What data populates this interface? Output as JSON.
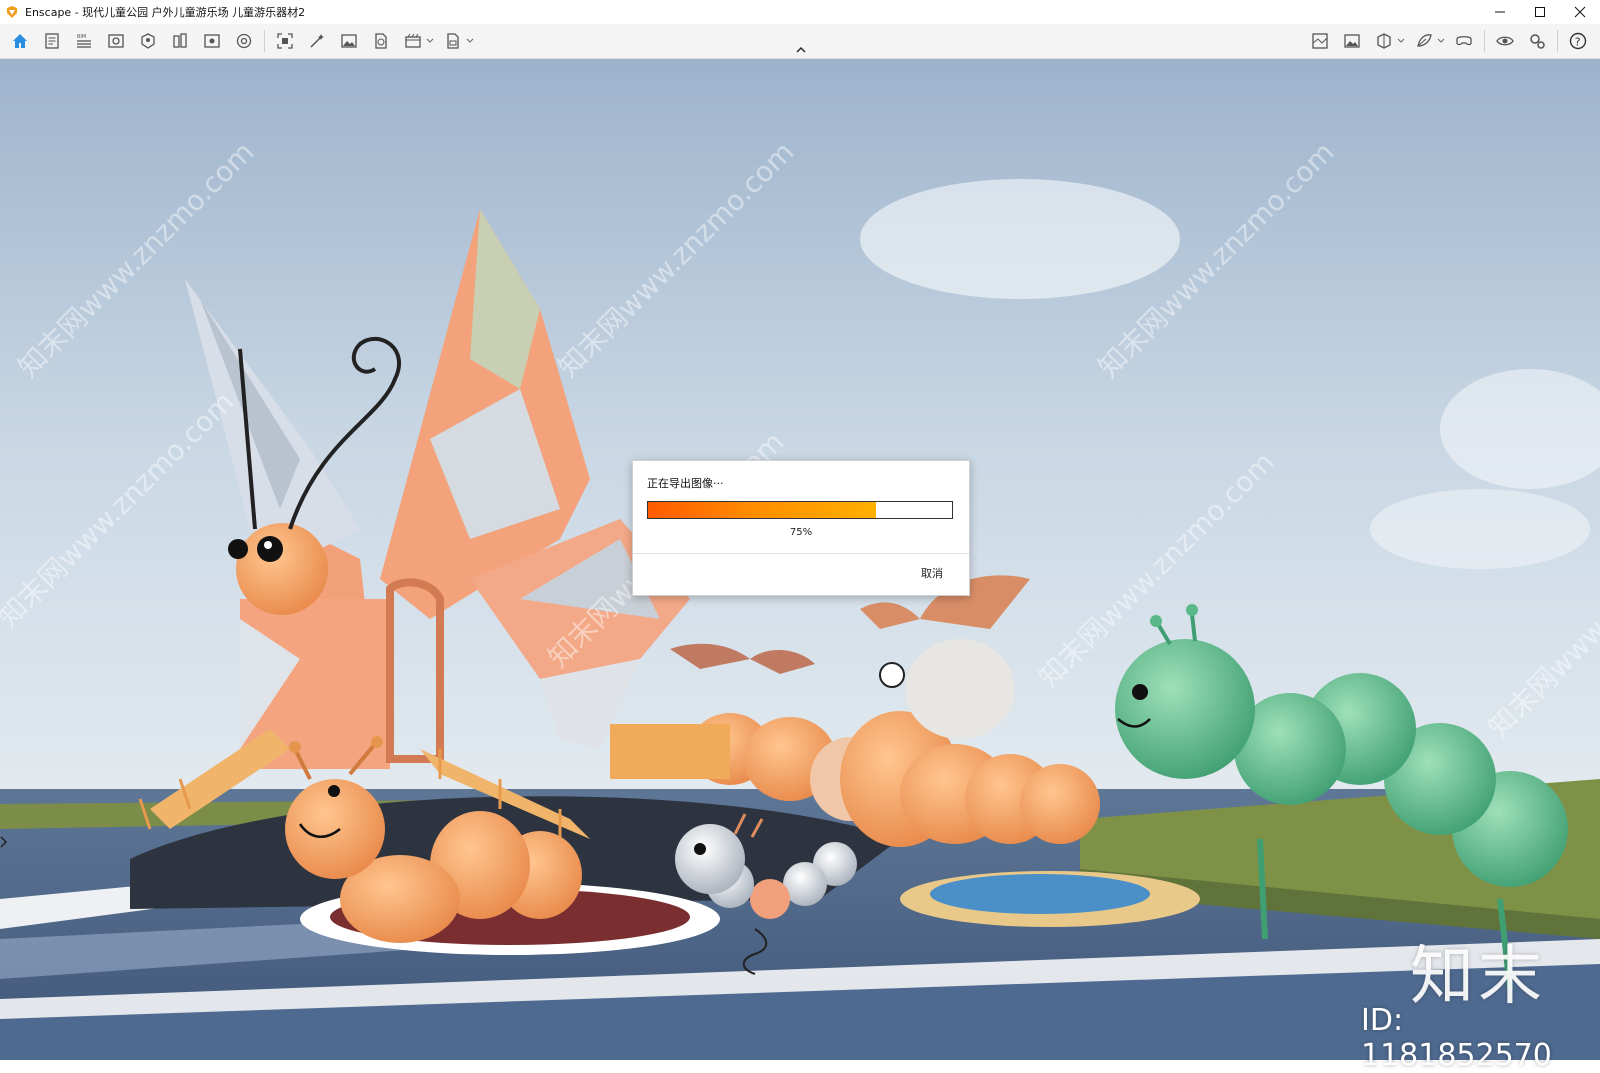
{
  "window": {
    "title": "Enscape - 现代儿童公园 户外儿童游乐场 儿童游乐器材2",
    "icon": "enscape-logo-icon",
    "controls": [
      "minimize-icon",
      "maximize-icon",
      "close-icon"
    ]
  },
  "toolbar": {
    "left_tools": [
      "home-icon",
      "document-icon",
      "bim-icon",
      "view-icon",
      "asset-library-icon",
      "materials-icon",
      "views-manager-icon",
      "atmosphere-icon",
      "screenshot-icon",
      "batch-render-icon",
      "image-icon",
      "panorama-icon",
      "video-editor-icon",
      "export-icon"
    ],
    "right_tools": [
      "map-icon",
      "image-settings-icon",
      "section-icon",
      "material-editor-icon",
      "vr-headset-icon",
      "visual-settings-icon",
      "general-settings-icon",
      "help-icon"
    ],
    "accent_color": "#2a8fe0"
  },
  "dialog": {
    "title": "正在导出图像···",
    "progress_percent": 75,
    "progress_label": "75%",
    "cancel_label": "取消"
  },
  "watermark": {
    "brand": "知末",
    "id_text": "ID: 1181852570",
    "diagonal_text": "知末网www.znzmo.com"
  }
}
